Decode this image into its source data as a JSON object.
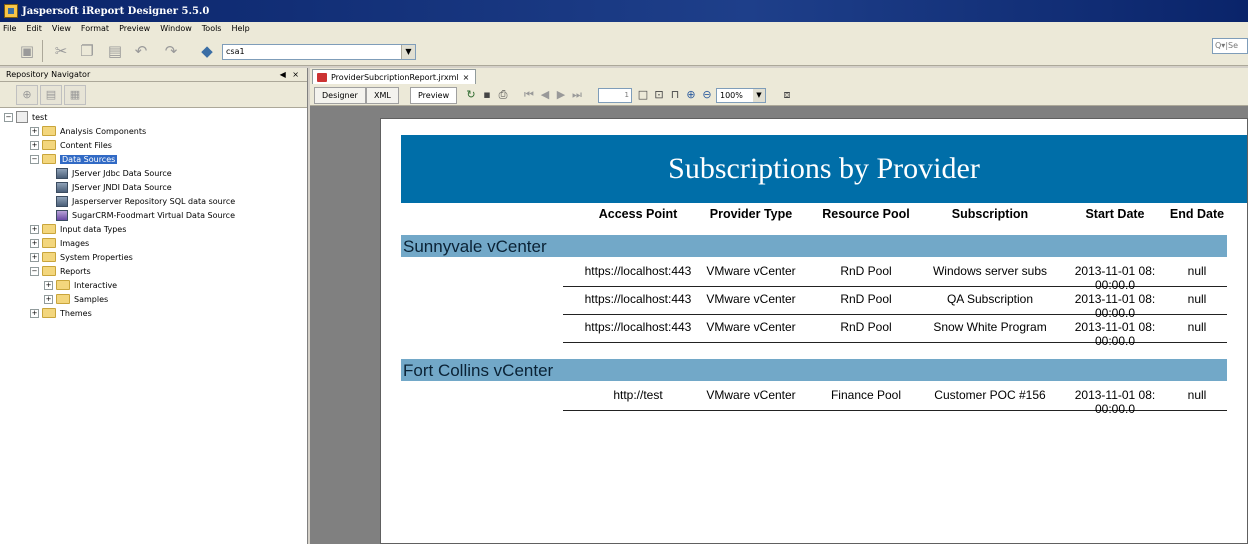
{
  "window": {
    "title": "Jaspersoft iReport Designer 5.5.0"
  },
  "menu": [
    "File",
    "Edit",
    "View",
    "Format",
    "Preview",
    "Window",
    "Tools",
    "Help"
  ],
  "toolbar": {
    "server": "csa1",
    "search_placeholder": "Se"
  },
  "repository": {
    "header": "Repository Navigator",
    "controls": "◀ ×",
    "root": "test",
    "items": {
      "analysis": "Analysis Components",
      "content": "Content Files",
      "datasources": "Data Sources",
      "ds1": "JServer Jdbc Data Source",
      "ds2": "JServer JNDI Data Source",
      "ds3": "Jasperserver Repository SQL data source",
      "ds4": "SugarCRM-Foodmart Virtual Data Source",
      "input": "Input data Types",
      "images": "Images",
      "sysprops": "System Properties",
      "reports": "Reports",
      "interactive": "Interactive",
      "samples": "Samples",
      "themes": "Themes"
    }
  },
  "editor": {
    "tab": "ProviderSubcriptionReport.jrxml",
    "views": [
      "Designer",
      "XML",
      "Preview"
    ],
    "page_number": "1",
    "zoom": "100%"
  },
  "report": {
    "title": "Subscriptions by Provider",
    "columns": [
      "Access Point",
      "Provider Type",
      "Resource Pool",
      "Subscription",
      "Start Date",
      "End Date"
    ],
    "groups": [
      {
        "name": "Sunnyvale vCenter",
        "rows": [
          [
            "https://localhost:443",
            "VMware vCenter",
            "RnD Pool",
            "Windows server subs",
            "2013-11-01 08:",
            "00:00.0",
            "null"
          ],
          [
            "https://localhost:443",
            "VMware vCenter",
            "RnD Pool",
            "QA Subscription",
            "2013-11-01 08:",
            "00:00.0",
            "null"
          ],
          [
            "https://localhost:443",
            "VMware vCenter",
            "RnD Pool",
            "Snow White Program",
            "2013-11-01 08:",
            "00:00.0",
            "null"
          ]
        ]
      },
      {
        "name": "Fort Collins vCenter",
        "rows": [
          [
            "http://test",
            "VMware vCenter",
            "Finance Pool",
            "Customer POC #156",
            "2013-11-01 08:",
            "00:00.0",
            "null"
          ]
        ]
      }
    ]
  }
}
